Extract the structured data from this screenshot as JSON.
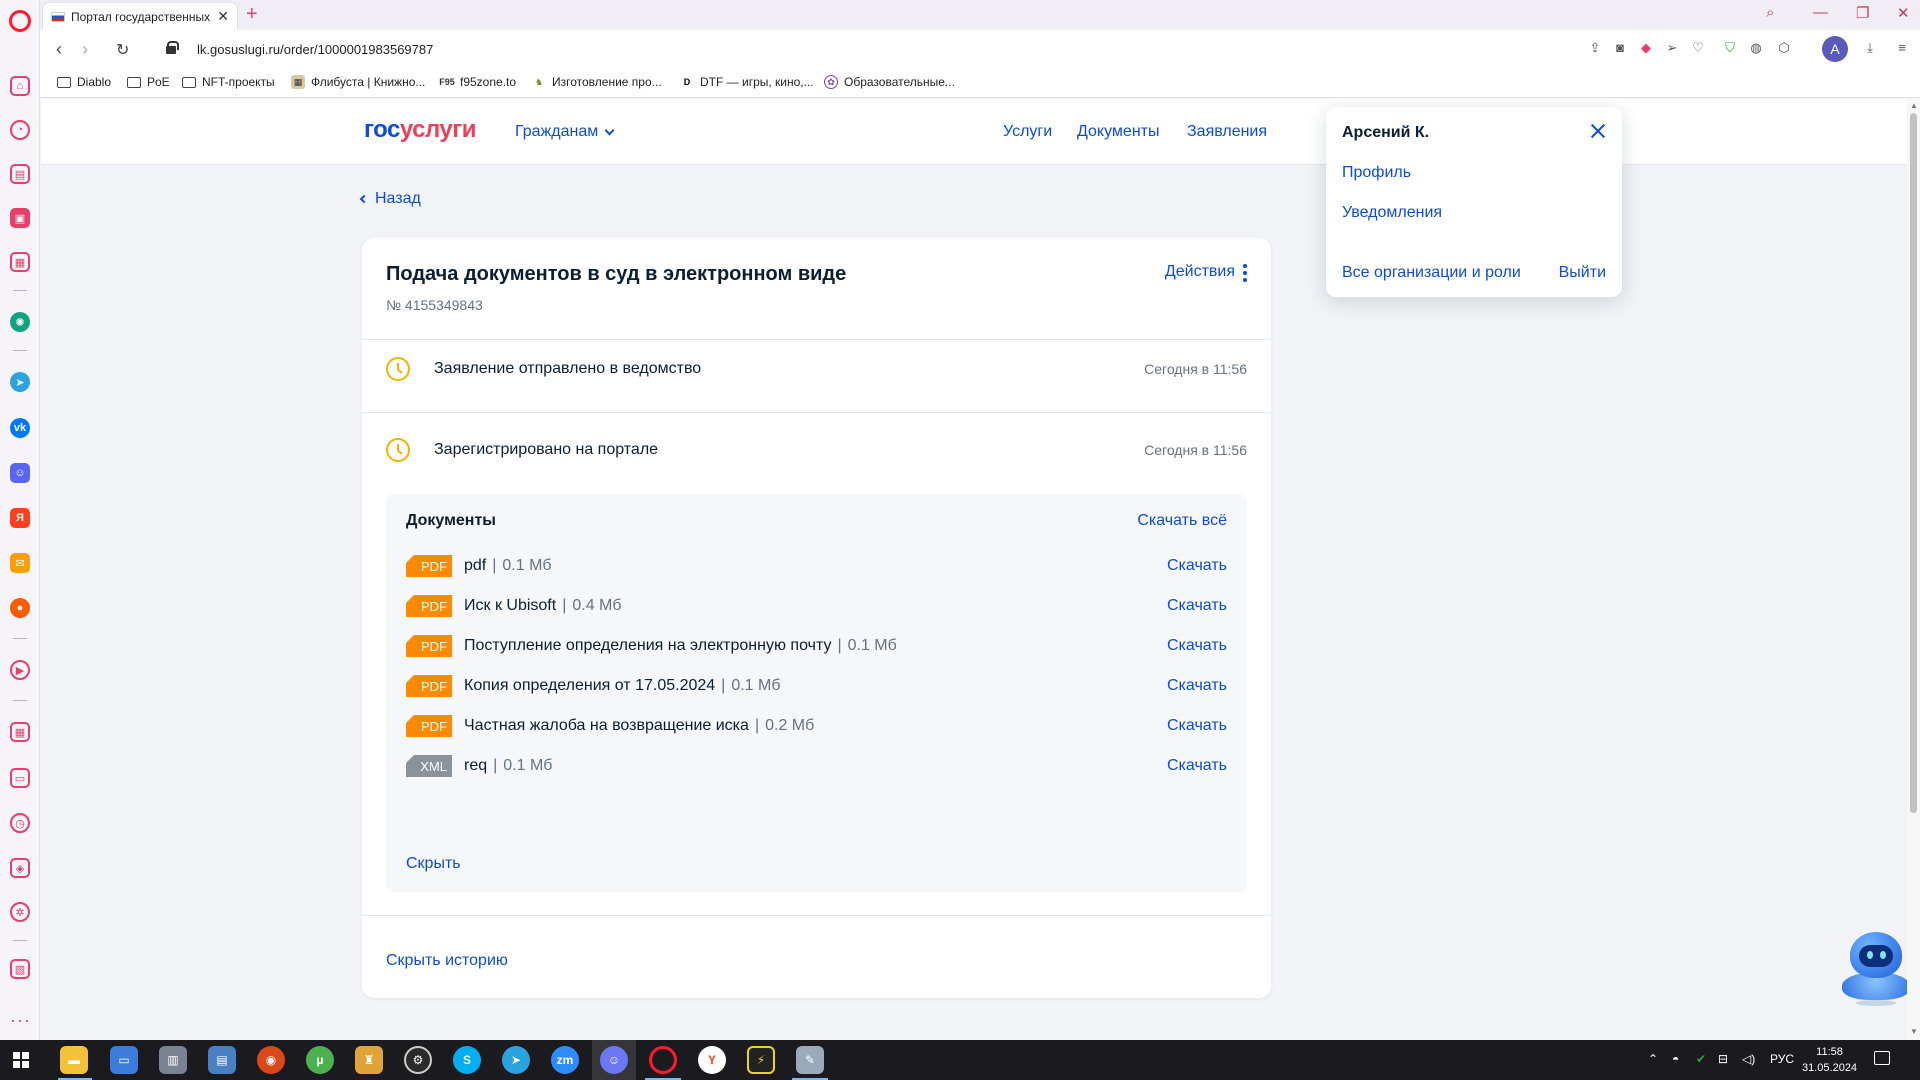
{
  "browser": {
    "tab_title": "Портал государственных у",
    "url": "lk.gosuslugi.ru/order/1000001983569787",
    "profile_initial": "A",
    "bookmarks": [
      {
        "label": "Diablo",
        "icon": "folder-icon"
      },
      {
        "label": "PoE",
        "icon": "folder-icon"
      },
      {
        "label": "NFT-проекты",
        "icon": "folder-icon"
      },
      {
        "label": "Флибуста | Книжно...",
        "icon": "flibusta-icon"
      },
      {
        "label": "f95zone.to",
        "icon": "f95zone-icon"
      },
      {
        "label": "Изготовление про...",
        "icon": "figure-icon"
      },
      {
        "label": "DTF — игры, кино,...",
        "icon": "dtf-icon"
      },
      {
        "label": "Образовательные...",
        "icon": "education-icon"
      }
    ]
  },
  "header": {
    "logo_part1": "гос",
    "logo_part2": "услуги",
    "audience": "Гражданам",
    "nav": [
      "Услуги",
      "Документы",
      "Заявления"
    ]
  },
  "back_label": "Назад",
  "order": {
    "title": "Подача документов в суд в электронном виде",
    "number": "№ 4155349843",
    "actions_label": "Действия",
    "statuses": [
      {
        "text": "Заявление отправлено в ведомство",
        "time": "Сегодня в 11:56"
      },
      {
        "text": "Зарегистрировано на портале",
        "time": "Сегодня в 11:56"
      }
    ],
    "documents": {
      "title": "Документы",
      "download_all": "Скачать всё",
      "items": [
        {
          "type": "PDF",
          "name": "pdf",
          "size": "0.1 Мб",
          "action": "Скачать"
        },
        {
          "type": "PDF",
          "name": "Иск к Ubisoft",
          "size": "0.4 Мб",
          "action": "Скачать"
        },
        {
          "type": "PDF",
          "name": "Поступление определения на электронную почту",
          "size": "0.1 Мб",
          "action": "Скачать"
        },
        {
          "type": "PDF",
          "name": "Копия определения от 17.05.2024",
          "size": "0.1 Мб",
          "action": "Скачать"
        },
        {
          "type": "PDF",
          "name": "Частная жалоба на возвращение иска",
          "size": "0.2 Мб",
          "action": "Скачать"
        },
        {
          "type": "XML",
          "name": "req",
          "size": "0.1 Мб",
          "action": "Скачать"
        }
      ],
      "separator": "|",
      "hide_label": "Скрыть"
    },
    "hide_history": "Скрыть историю"
  },
  "profile_menu": {
    "name": "Арсений К.",
    "links": [
      "Профиль",
      "Уведомления",
      "Все организации и роли"
    ],
    "logout": "Выйти"
  },
  "taskbar": {
    "lang": "РУС",
    "time": "11:58",
    "date": "31.05.2024"
  },
  "colors": {
    "brand_blue": "#0d4cd3",
    "brand_red": "#ee3f58",
    "pdf_badge": "#ff8a00",
    "xml_badge": "#8a929b",
    "status_pending": "#f5b200",
    "opera_red": "#ff1b2d"
  }
}
